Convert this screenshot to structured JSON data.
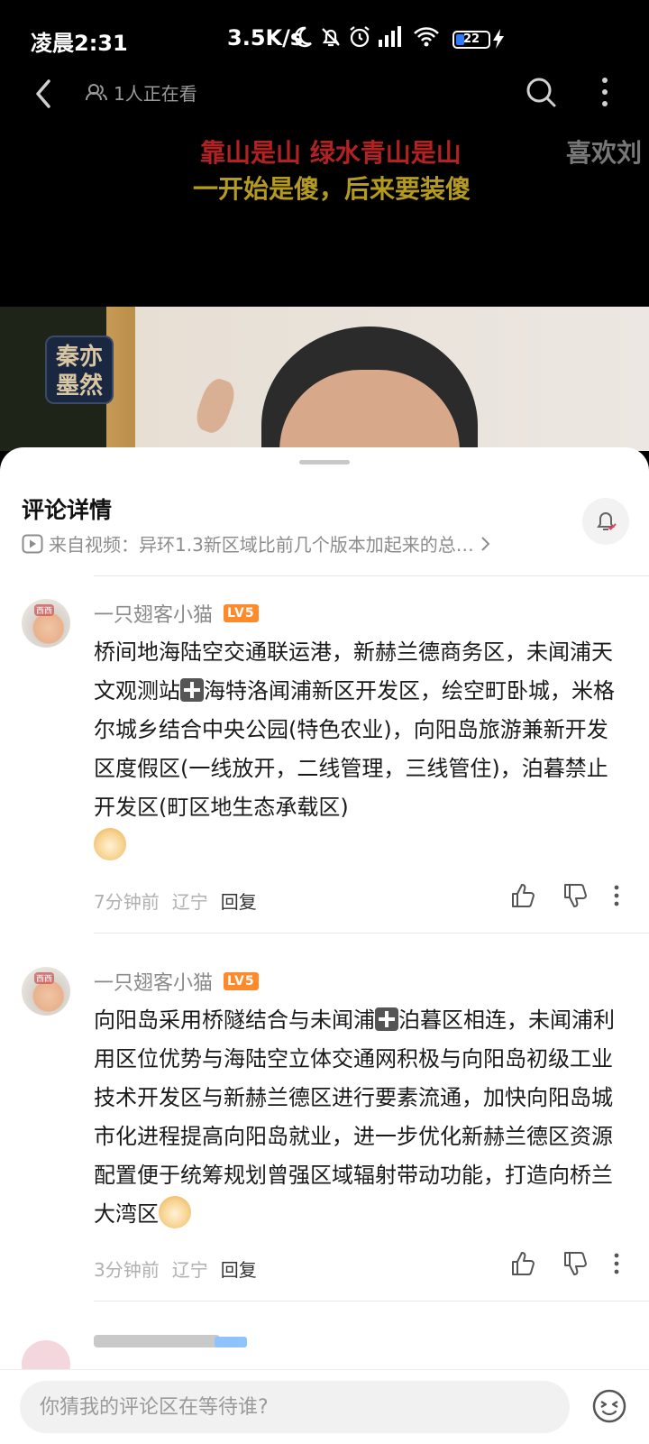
{
  "status_bar": {
    "time": "凌晨2:31",
    "net_speed": "3.5K/s",
    "battery_level": "22"
  },
  "video": {
    "viewers": "1人正在看",
    "danmaku": [
      "靠山是山  绿水青山是山",
      "喜欢刘",
      "一开始是傻，后来要装傻"
    ],
    "channel_logo": "秦亦墨然",
    "colors": {
      "danmaku_red": "#b32222",
      "danmaku_yellow": "#b49a1e"
    }
  },
  "sheet": {
    "title": "评论详情",
    "source": "来自视频：异环1.3新区域比前几个版本加起来的总…"
  },
  "comments": [
    {
      "user": "一只翅客小猫",
      "level": "LV5",
      "text_parts": [
        "桥间地海陆空交通联运港，新赫兰德商务区，未闻浦天文观测站",
        "海特洛闻浦新区开发区，绘空町卧城，米格尔城乡结合中央公园(特色农业)，向阳岛旅游兼新开发区度假区(一线放开，二线管理，三线管住)，泊暮禁止开发区(町区地生态承载区)"
      ],
      "time": "7分钟前",
      "location": "辽宁",
      "reply": "回复"
    },
    {
      "user": "一只翅客小猫",
      "level": "LV5",
      "text_parts": [
        "向阳岛采用桥隧结合与未闻浦",
        "泊暮区相连，未闻浦利用区位优势与海陆空立体交通网积极与向阳岛初级工业技术开发区与新赫兰德区进行要素流通，加快向阳岛城市化进程提高向阳岛就业，进一步优化新赫兰德区资源配置便于统筹规划曾强区域辐射带动功能，打造向桥兰大湾区"
      ],
      "time": "3分钟前",
      "location": "辽宁",
      "reply": "回复"
    }
  ],
  "input": {
    "placeholder": "你猜我的评论区在等待谁?"
  },
  "icons": [
    "back-icon",
    "people-icon",
    "search-icon",
    "more-icon",
    "bell-icon",
    "play-icon",
    "chevron-right-icon",
    "thumbs-up-icon",
    "thumbs-down-icon",
    "emoji-icon"
  ]
}
